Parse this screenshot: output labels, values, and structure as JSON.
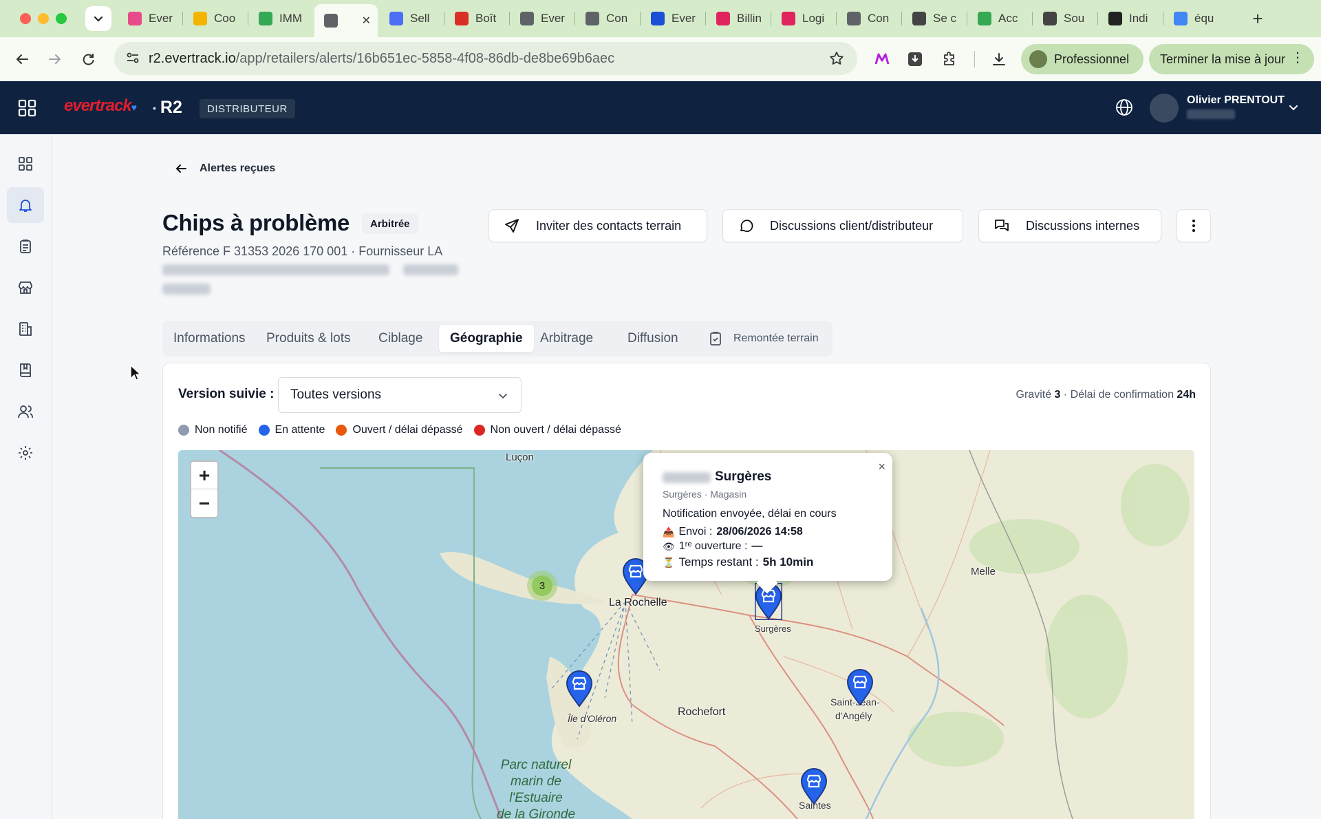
{
  "browser": {
    "tabs": [
      {
        "label": "Ever",
        "color": "#e84b8a"
      },
      {
        "label": "Coo",
        "color": "#f4b400"
      },
      {
        "label": "IMM",
        "color": "#34a853"
      },
      {
        "label": "",
        "color": "#5f6368"
      },
      {
        "label": "Sell",
        "color": "#4c6ef5"
      },
      {
        "label": "Boît",
        "color": "#d93025"
      },
      {
        "label": "Ever",
        "color": "#5f6368"
      },
      {
        "label": "Con",
        "color": "#5f6368"
      },
      {
        "label": "Ever",
        "color": "#1a4fd6"
      },
      {
        "label": "Billin",
        "color": "#e0245e"
      },
      {
        "label": "Logi",
        "color": "#e0245e"
      },
      {
        "label": "Con",
        "color": "#5f6368"
      },
      {
        "label": "Se c",
        "color": "#444444"
      },
      {
        "label": "Acc",
        "color": "#34a853"
      },
      {
        "label": "Sou",
        "color": "#444444"
      },
      {
        "label": "Indi",
        "color": "#222222"
      },
      {
        "label": "équ",
        "color": "#4285f4"
      }
    ],
    "url_host": "r2.evertrack.io",
    "url_path": "/app/retailers/alerts/16b651ec-5858-4f08-86db-de8be69b6aec",
    "profile_label": "Professionnel",
    "update_label": "Terminer la mise à jour"
  },
  "header": {
    "logo": "evertrack",
    "product": "R2",
    "role_badge": "DISTRIBUTEUR",
    "user_name": "Olivier PRENTOUT"
  },
  "page": {
    "back_label": "Alertes reçues",
    "title": "Chips à problème",
    "status": "Arbitrée",
    "reference": "Référence F 31353 2026 170 001 · Fournisseur LA",
    "actions": {
      "invite": "Inviter des contacts terrain",
      "discussions_cd": "Discussions client/distributeur",
      "discussions_internal": "Discussions internes"
    },
    "tabs": [
      "Informations",
      "Produits & lots",
      "Ciblage",
      "Géographie",
      "Arbitrage",
      "Diffusion",
      "Remontée terrain"
    ],
    "active_tab": "Géographie"
  },
  "geo": {
    "version_label": "Version suivie :",
    "version_value": "Toutes versions",
    "gravity_label": "Gravité",
    "gravity_value": "3",
    "delay_label": "Délai de confirmation",
    "delay_value": "24h",
    "legend": [
      {
        "label": "Non notifié",
        "color": "#8e9bb0"
      },
      {
        "label": "En attente",
        "color": "#2563eb"
      },
      {
        "label": "Ouvert / délai dépassé",
        "color": "#ea580c"
      },
      {
        "label": "Non ouvert / délai dépassé",
        "color": "#dc2626"
      }
    ],
    "map": {
      "zoom_in": "+",
      "zoom_out": "−",
      "cluster_count": "3",
      "labels": {
        "lucon": "Luçon",
        "la_rochelle": "La Rochelle",
        "surgeres": "Surgères",
        "melle": "Melle",
        "oleron": "Île d'Oléron",
        "rochefort": "Rochefort",
        "saint_jean_1": "Saint-Jean-",
        "saint_jean_2": "d'Angély",
        "saintes": "Saintes",
        "park_1": "Parc naturel",
        "park_2": "marin de",
        "park_3": "l'Estuaire",
        "park_4": "de la Gironde"
      },
      "popup": {
        "title": "Surgères",
        "subtitle": "Surgères · Magasin",
        "status": "Notification envoyée, délai en cours",
        "sent_label": "Envoi :",
        "sent_value": "28/06/2026 14:58",
        "open_label": "1ʳᵉ ouverture :",
        "open_value": "—",
        "remaining_label": "Temps restant :",
        "remaining_value": "5h 10min",
        "close": "×"
      }
    }
  }
}
